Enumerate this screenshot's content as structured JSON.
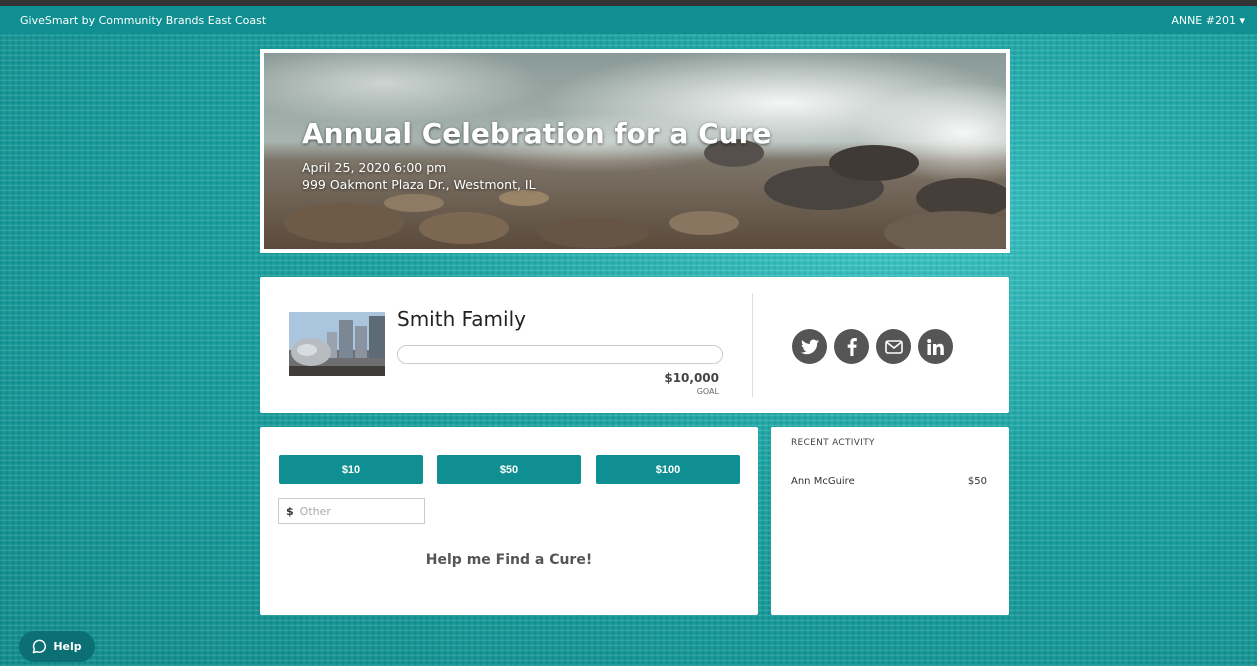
{
  "topbar": {
    "brand": "GiveSmart by Community Brands East Coast",
    "user_label": "ANNE  #201 ▾"
  },
  "event": {
    "title": "Annual Celebration for a Cure",
    "datetime": "April 25, 2020 6:00 pm",
    "address": "999 Oakmont Plaza Dr., Westmont, IL"
  },
  "profile": {
    "name": "Smith Family",
    "progress_fraction": 0,
    "goal_amount": "$10,000",
    "goal_label": "GOAL"
  },
  "social": {
    "icons": [
      "twitter-icon",
      "facebook-icon",
      "email-icon",
      "linkedin-icon"
    ],
    "color": "#555555"
  },
  "donate": {
    "amounts": [
      "$10",
      "$50",
      "$100"
    ],
    "currency_symbol": "$",
    "other_placeholder": "Other",
    "tagline": "Help me Find a Cure!"
  },
  "activity": {
    "heading": "RECENT ACTIVITY",
    "items": [
      {
        "name": "Ann McGuire",
        "amount": "$50"
      }
    ]
  },
  "help": {
    "label": "Help"
  },
  "colors": {
    "accent": "#0f8f91",
    "background": "#1aa3a3",
    "help_button": "#0b6f73"
  }
}
